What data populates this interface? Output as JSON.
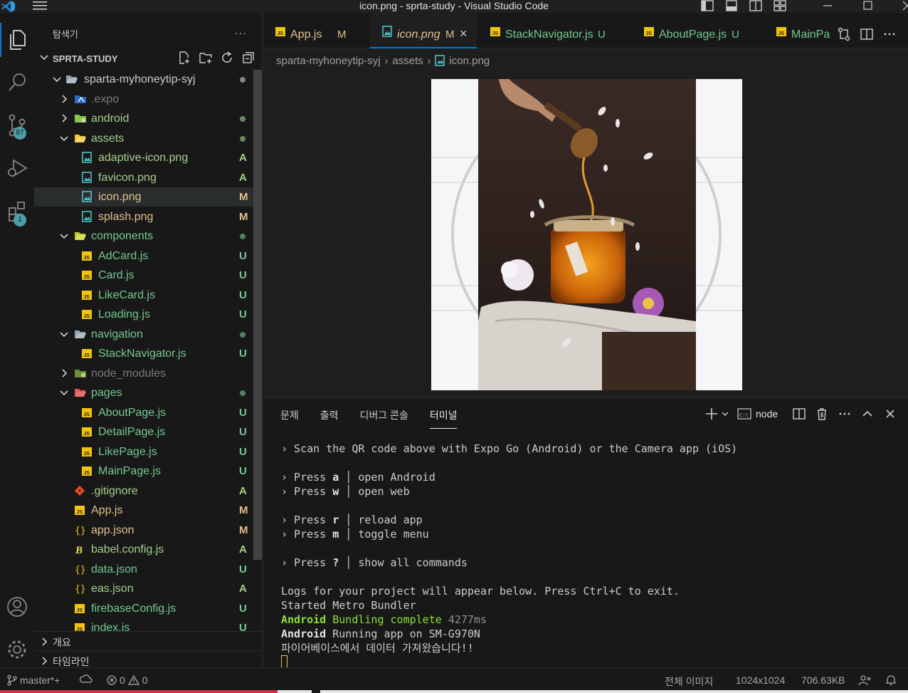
{
  "window": {
    "title": "icon.png - sprta-study - Visual Studio Code"
  },
  "activity_bar": {
    "items": [
      {
        "icon": "explorer-icon"
      },
      {
        "icon": "search-icon"
      },
      {
        "icon": "source-control-icon",
        "badge": "87"
      },
      {
        "icon": "run-debug-icon"
      },
      {
        "icon": "extensions-icon",
        "badge": "1"
      }
    ],
    "bottom": [
      {
        "icon": "accounts-icon"
      },
      {
        "icon": "settings-gear-icon"
      }
    ]
  },
  "sidebar": {
    "header": "탐색기",
    "more": "···",
    "project": "SPRTA-STUDY",
    "tree": [
      {
        "label": "sparta-myhoneytip-syj",
        "status": "dot",
        "depth": 1,
        "kind": "folder-open",
        "color": "#cccccc"
      },
      {
        "label": ".expo",
        "status": "",
        "depth": 2,
        "kind": "folder-expo",
        "color": "#7a7a7a"
      },
      {
        "label": "android",
        "status": "dot",
        "depth": 2,
        "kind": "folder-android",
        "color": "#a5d18a"
      },
      {
        "label": "assets",
        "status": "dot",
        "depth": 2,
        "kind": "folder-assets-open",
        "color": "#a5d18a"
      },
      {
        "label": "adaptive-icon.png",
        "status": "A",
        "depth": 3,
        "kind": "image",
        "color": "#a5d18a"
      },
      {
        "label": "favicon.png",
        "status": "A",
        "depth": 3,
        "kind": "image",
        "color": "#a5d18a"
      },
      {
        "label": "icon.png",
        "status": "M",
        "depth": 3,
        "kind": "image",
        "color": "#e2c08d",
        "active": true
      },
      {
        "label": "splash.png",
        "status": "M",
        "depth": 3,
        "kind": "image",
        "color": "#e2c08d"
      },
      {
        "label": "components",
        "status": "dot",
        "depth": 2,
        "kind": "folder-components-open",
        "color": "#73c991"
      },
      {
        "label": "AdCard.js",
        "status": "U",
        "depth": 3,
        "kind": "js",
        "color": "#73c991"
      },
      {
        "label": "Card.js",
        "status": "U",
        "depth": 3,
        "kind": "js",
        "color": "#73c991"
      },
      {
        "label": "LikeCard.js",
        "status": "U",
        "depth": 3,
        "kind": "js",
        "color": "#73c991"
      },
      {
        "label": "Loading.js",
        "status": "U",
        "depth": 3,
        "kind": "js",
        "color": "#73c991"
      },
      {
        "label": "navigation",
        "status": "dot",
        "depth": 2,
        "kind": "folder-open",
        "color": "#73c991"
      },
      {
        "label": "StackNavigator.js",
        "status": "U",
        "depth": 3,
        "kind": "js",
        "color": "#73c991"
      },
      {
        "label": "node_modules",
        "status": "",
        "depth": 2,
        "kind": "folder-node",
        "color": "#7a7a7a"
      },
      {
        "label": "pages",
        "status": "dot",
        "depth": 2,
        "kind": "folder-pages-open",
        "color": "#73c991"
      },
      {
        "label": "AboutPage.js",
        "status": "U",
        "depth": 3,
        "kind": "js",
        "color": "#73c991"
      },
      {
        "label": "DetailPage.js",
        "status": "U",
        "depth": 3,
        "kind": "js",
        "color": "#73c991"
      },
      {
        "label": "LikePage.js",
        "status": "U",
        "depth": 3,
        "kind": "js",
        "color": "#73c991"
      },
      {
        "label": "MainPage.js",
        "status": "U",
        "depth": 3,
        "kind": "js",
        "color": "#73c991"
      },
      {
        "label": ".gitignore",
        "status": "A",
        "depth": 2,
        "kind": "git",
        "color": "#a5d18a"
      },
      {
        "label": "App.js",
        "status": "M",
        "depth": 2,
        "kind": "js",
        "color": "#e2c08d"
      },
      {
        "label": "app.json",
        "status": "M",
        "depth": 2,
        "kind": "json",
        "color": "#e2c08d"
      },
      {
        "label": "babel.config.js",
        "status": "A",
        "depth": 2,
        "kind": "babel",
        "color": "#a5d18a"
      },
      {
        "label": "data.json",
        "status": "U",
        "depth": 2,
        "kind": "json",
        "color": "#73c991"
      },
      {
        "label": "eas.json",
        "status": "A",
        "depth": 2,
        "kind": "json",
        "color": "#a5d18a"
      },
      {
        "label": "firebaseConfig.js",
        "status": "U",
        "depth": 2,
        "kind": "js",
        "color": "#73c991"
      },
      {
        "label": "index.js",
        "status": "U",
        "depth": 2,
        "kind": "js",
        "color": "#73c991"
      }
    ],
    "sections": [
      "개요",
      "타임라인"
    ]
  },
  "tabs": [
    {
      "label": "App.js",
      "status": "M",
      "kind": "js",
      "color": "#e2c08d"
    },
    {
      "label": "icon.png",
      "status": "M",
      "kind": "image",
      "color": "#e2c08d",
      "active": true
    },
    {
      "label": "StackNavigator.js",
      "status": "U",
      "kind": "js",
      "color": "#73c991"
    },
    {
      "label": "AboutPage.js",
      "status": "U",
      "kind": "js",
      "color": "#73c991"
    },
    {
      "label": "MainPa",
      "status": "",
      "kind": "js",
      "color": "#73c991"
    }
  ],
  "breadcrumb": [
    "sparta-myhoneytip-syj",
    "assets",
    "icon.png"
  ],
  "panel": {
    "tabs": [
      "문제",
      "출력",
      "디버그 콘솔",
      "터미널"
    ],
    "active_tab": "터미널",
    "terminal_name": "node",
    "terminal": {
      "scan": "› Scan the QR code above with Expo Go (Android) or the Camera app (iOS)",
      "press": "› Press",
      "k_a": "a",
      "t_a": "open Android",
      "k_w": "w",
      "t_w": "open web",
      "k_r": "r",
      "t_r": "reload app",
      "k_m": "m",
      "t_m": "toggle menu",
      "k_q": "?",
      "t_q": "show all commands",
      "logs": "Logs for your project will appear below. Press Ctrl+C to exit.",
      "metro": "Started Metro Bundler",
      "android": "Android",
      "bundling": "Bundling complete",
      "bundle_ms": "4277ms",
      "running": "Running app on SM-G970N",
      "firebase": "파이어베이스에서 데이터 가져왔습니다!!"
    }
  },
  "statusbar": {
    "branch": "master*+",
    "errors": "0",
    "warnings": "0",
    "image_mode": "전체 이미지",
    "dimensions": "1024x1024",
    "size": "706.63KB"
  }
}
